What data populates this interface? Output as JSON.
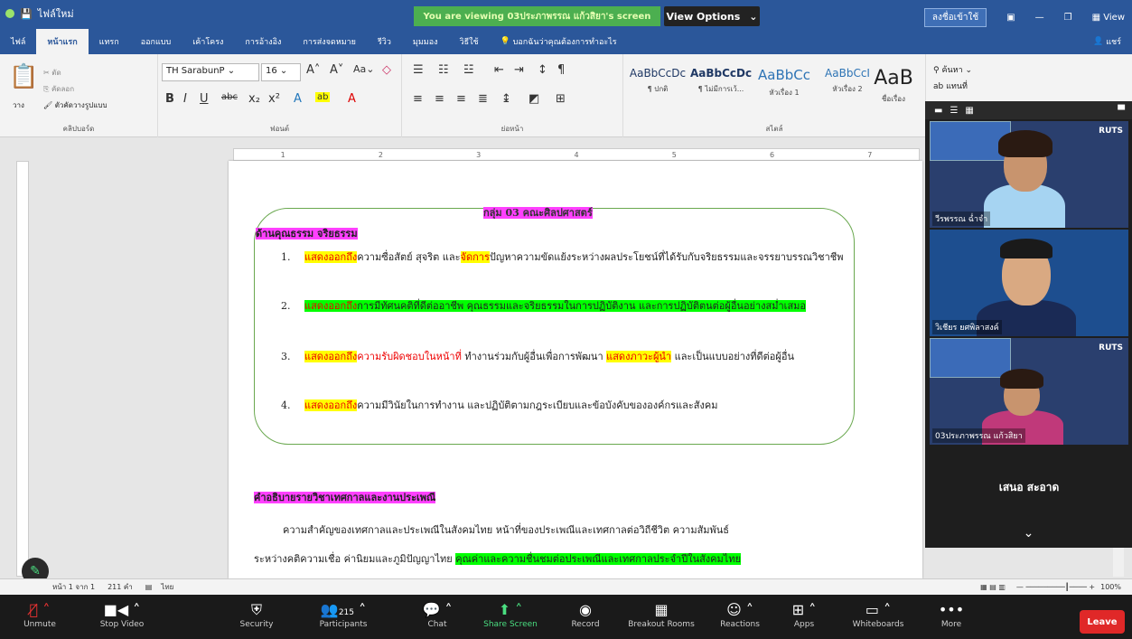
{
  "titlebar": {
    "app_title": "ไฟล์ใหม่",
    "share_banner": "You are viewing 03ประภาพรรณ แก้วสิยา's screen",
    "view_options": "View Options",
    "right_button": "ลงชื่อเข้าใช้",
    "view_label": "View"
  },
  "ribbon_tabs": [
    "ไฟล์",
    "หน้าแรก",
    "แทรก",
    "ออกแบบ",
    "เค้าโครง",
    "การอ้างอิง",
    "การส่งจดหมาย",
    "รีวิว",
    "มุมมอง",
    "วิธีใช้",
    "บอกฉันว่าคุณต้องการทำอะไร"
  ],
  "ribbon_share": "แชร์",
  "clipboard": {
    "paste": "วาง",
    "cut": "ตัด",
    "copy": "คัดลอก",
    "format_painter": "ตัวคัดวางรูปแบบ",
    "label": "คลิปบอร์ด"
  },
  "font": {
    "name": "TH SarabunP",
    "size": "16",
    "label": "ฟอนต์"
  },
  "paragraph_label": "ย่อหน้า",
  "styles": {
    "label": "สไตล์",
    "items": [
      {
        "sample": "AaBbCcDc",
        "name": "¶ ปกติ"
      },
      {
        "sample": "AaBbCcDc",
        "name": "¶ ไม่มีการเว้...",
        "bold": true
      },
      {
        "sample": "AaBbCc",
        "name": "หัวเรื่อง 1"
      },
      {
        "sample": "AaBbCcI",
        "name": "หัวเรื่อง 2"
      },
      {
        "sample": "AaB",
        "name": "ชื่อเรื่อง"
      }
    ]
  },
  "editing": {
    "find": "ค้นหา",
    "replace": "แทนที่"
  },
  "ruler": [
    "1",
    "2",
    "3",
    "4",
    "5",
    "6",
    "7"
  ],
  "document": {
    "group_title": "กลุ่ม 03 คณะศิลปศาสตร์",
    "section1_title": "ด้านคุณธรรม จริยธรรม",
    "items": [
      {
        "num": "1.",
        "parts": [
          {
            "t": "แสดงออกถึง",
            "c": "yel-red"
          },
          {
            "t": "ความซื่อสัตย์ สุจริต และ",
            "c": ""
          },
          {
            "t": "จัดการ",
            "c": "yel-red"
          },
          {
            "t": "ปัญหาความขัดแย้งระหว่างผลประโยชน์ที่ได้รับกับจริยธรรมและจรรยาบรรณวิชาชีพ",
            "c": ""
          }
        ]
      },
      {
        "num": "2.",
        "parts": [
          {
            "t": "แสดงออกถึง",
            "c": "grn-red"
          },
          {
            "t": "การมีทัศนคติที่ดีต่ออาชีพ คุณธรรมและจริยธรรมในการปฏิบัติงาน และการปฏิบัติตนต่อผู้อื่นอย่างสม่ำเสมอ",
            "c": "grn"
          }
        ]
      },
      {
        "num": "3.",
        "parts": [
          {
            "t": "แสดงออกถึง",
            "c": "yel-red"
          },
          {
            "t": "ความรับผิดชอบในหน้าที่",
            "c": "red"
          },
          {
            "t": " ทำงานร่วมกับผู้อื่นเพื่อการพัฒนา ",
            "c": ""
          },
          {
            "t": "แสดงภาวะผู้นำ",
            "c": "yel-red"
          },
          {
            "t": " และเป็นแบบอย่างที่ดีต่อผู้อื่น",
            "c": ""
          }
        ]
      },
      {
        "num": "4.",
        "parts": [
          {
            "t": "แสดงออกถึง",
            "c": "yel-red"
          },
          {
            "t": "ความมีวินัยในการทำงาน และปฏิบัติตามกฎระเบียบและข้อบังคับขององค์กรและสังคม",
            "c": ""
          }
        ]
      }
    ],
    "section2_title": "คำอธิบายรายวิชาเทศกาลและงานประเพณี",
    "para1": "ความสำคัญของเทศกาลและประเพณีในสังคมไทย   หน้าที่ของประเพณีและเทศกาลต่อวิถีชีวิต   ความสัมพันธ์",
    "para2_plain": "ระหว่างคติความเชื่อ ค่านิยมและภูมิปัญญาไทย ",
    "para2_hl": "คุณค่าและความชื่นชมต่อประเพณีและเทศกาลประจำปีในสังคมไทย"
  },
  "statusbar": {
    "page": "หน้า 1 จาก 1",
    "words": "211 คำ",
    "lang": "ไทย",
    "zoom": "100%"
  },
  "video": {
    "tiles": [
      {
        "name": "วีรพรรณ ฉ่ำจำ"
      },
      {
        "name": "วิเชียร ยศพิลาสงค์"
      },
      {
        "name": "03ประภาพรรณ แก้วสิยา"
      }
    ],
    "active_speaker": "เสนอ สะอาด",
    "logo": "RUTS"
  },
  "zoom_toolbar": {
    "buttons": [
      {
        "label": "Unmute",
        "icon": "mic-off-icon"
      },
      {
        "label": "Stop Video",
        "icon": "video-icon"
      },
      {
        "label": "Security",
        "icon": "shield-icon"
      },
      {
        "label": "Participants",
        "icon": "people-icon",
        "count": "215"
      },
      {
        "label": "Chat",
        "icon": "chat-icon"
      },
      {
        "label": "Share Screen",
        "icon": "share-icon"
      },
      {
        "label": "Record",
        "icon": "record-icon"
      },
      {
        "label": "Breakout Rooms",
        "icon": "breakout-icon"
      },
      {
        "label": "Reactions",
        "icon": "reactions-icon"
      },
      {
        "label": "Apps",
        "icon": "apps-icon"
      },
      {
        "label": "Whiteboards",
        "icon": "whiteboard-icon"
      },
      {
        "label": "More",
        "icon": "more-icon"
      }
    ],
    "leave": "Leave"
  }
}
